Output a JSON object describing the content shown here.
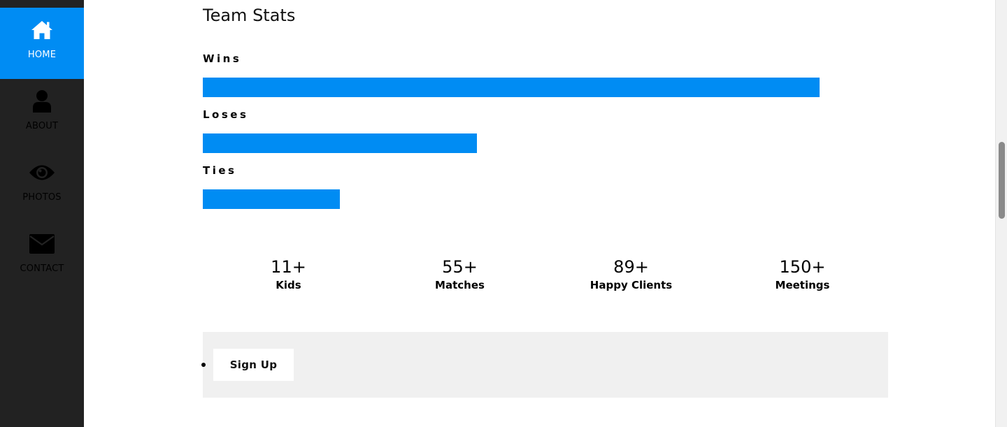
{
  "sidebar": {
    "items": [
      {
        "label": "HOME",
        "icon": "home-icon",
        "active": true
      },
      {
        "label": "ABOUT",
        "icon": "user-icon",
        "active": false
      },
      {
        "label": "PHOTOS",
        "icon": "eye-icon",
        "active": false
      },
      {
        "label": "CONTACT",
        "icon": "envelope-icon",
        "active": false
      }
    ],
    "active_color": "#008cf3",
    "background_color": "#222222"
  },
  "team_stats": {
    "title": "Team Stats",
    "bar_color": "#008cf3",
    "bars": [
      {
        "label": "Wins",
        "fraction": 0.9
      },
      {
        "label": "Loses",
        "fraction": 0.4
      },
      {
        "label": "Ties",
        "fraction": 0.2
      }
    ]
  },
  "counters": [
    {
      "value": "11+",
      "label": "Kids"
    },
    {
      "value": "55+",
      "label": "Matches"
    },
    {
      "value": "89+",
      "label": "Happy Clients"
    },
    {
      "value": "150+",
      "label": "Meetings"
    }
  ],
  "signup": {
    "button_label": "Sign Up"
  }
}
